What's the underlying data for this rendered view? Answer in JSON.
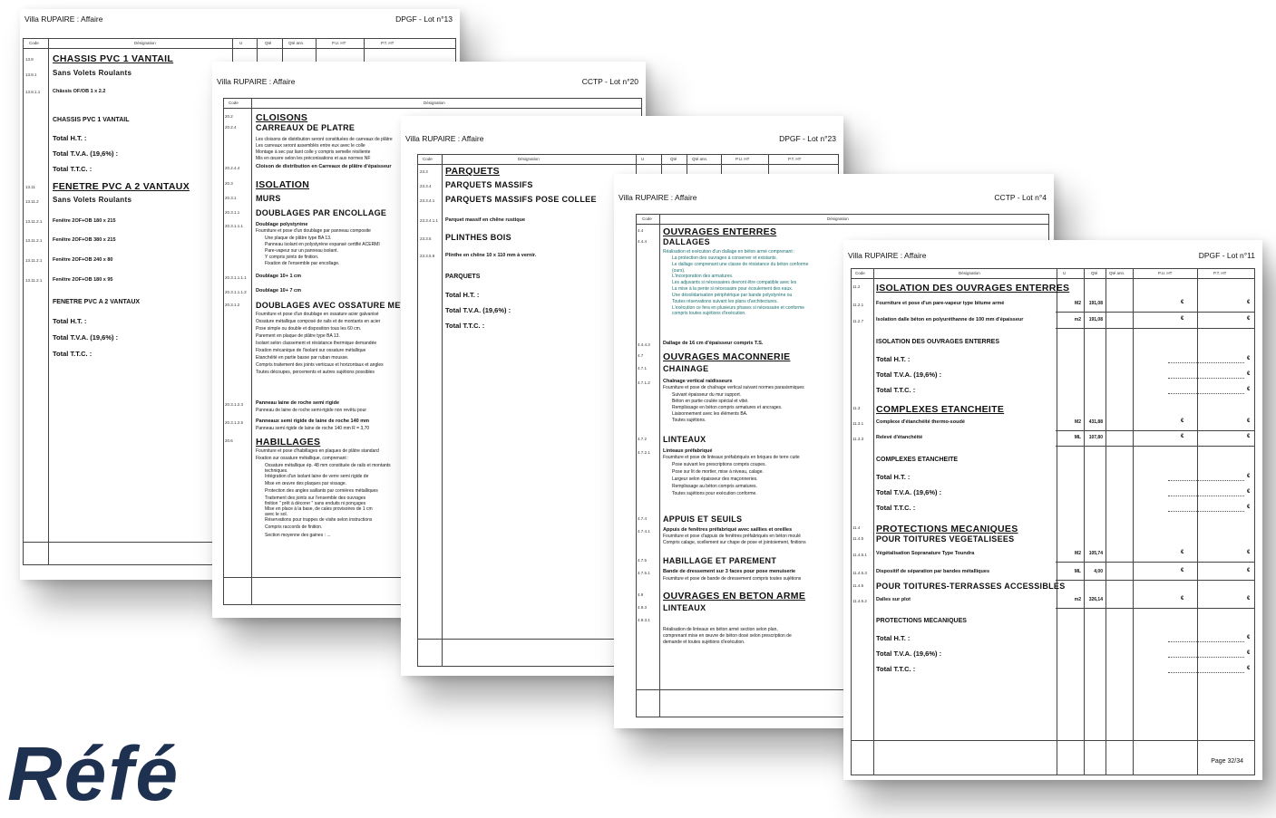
{
  "watermark": "Réfé",
  "p1": {
    "title_left": "Villa RUPAIRE : Affaire",
    "title_right": "DPGF - Lot n°13",
    "cols": {
      "code": "Code",
      "des": "Désignation",
      "u": "U",
      "qte": "Qté",
      "qteann": "Qté ann.",
      "pu": "P.U. HT",
      "pt": "P.T. HT"
    },
    "items": [
      {
        "code": "13.8",
        "text": "CHASSIS PVC 1 VANTAIL"
      },
      {
        "code": "13.8.1",
        "text": "Sans Volets Roulants"
      },
      {
        "code": "13.8.1.1",
        "text": "Châssis OF/OB 1 x 2.2"
      },
      {
        "code": "",
        "text": "CHASSIS PVC 1 VANTAIL"
      },
      {
        "code": "",
        "text": "Total H.T. :"
      },
      {
        "code": "",
        "text": "Total T.V.A. (19,6%) :"
      },
      {
        "code": "",
        "text": "Total T.T.C. :"
      },
      {
        "code": "13.11",
        "text": "FENETRE PVC A 2 VANTAUX"
      },
      {
        "code": "13.11.2",
        "text": "Sans Volets Roulants"
      },
      {
        "code": "13.11.2.1",
        "text": "Fenêtre 2OF+OB 180 x 215"
      },
      {
        "code": "13.11.2.1",
        "text": "Fenêtre 2OF+OB 380 x 215"
      },
      {
        "code": "13.11.2.1",
        "text": "Fenêtre 2OF+OB 240 x 80"
      },
      {
        "code": "13.11.2.1",
        "text": "Fenêtre 2OF+OB 180 x 95"
      },
      {
        "code": "",
        "text": "FENETRE PVC A 2 VANTAUX"
      },
      {
        "code": "",
        "text": "Total H.T. :"
      },
      {
        "code": "",
        "text": "Total T.V.A. (19,6%) :"
      },
      {
        "code": "",
        "text": "Total T.T.C. :"
      }
    ]
  },
  "p2": {
    "title_left": "Villa RUPAIRE : Affaire",
    "title_right": "CCTP - Lot n°20",
    "cols": {
      "code": "Code",
      "des": "Désignation"
    },
    "items": [
      {
        "code": "20.2",
        "text": "CLOISONS"
      },
      {
        "code": "20.2.4",
        "text": "CARREAUX DE PLATRE"
      },
      {
        "code": "",
        "text": "Les cloisons de distribution seront constituées de carreaux de plâtre"
      },
      {
        "code": "",
        "text": "Les carreaux seront assemblés entre eux avec le colle"
      },
      {
        "code": "",
        "text": "Montage à sec par liant colle y compris semelle résiliente"
      },
      {
        "code": "",
        "text": "Mis en œuvre selon les préconisations et aux normes NF"
      },
      {
        "code": "20.2.4.4",
        "text": "Cloison de distribution en Carreaux de plâtre d'épaisseur"
      },
      {
        "code": "20.3",
        "text": "ISOLATION"
      },
      {
        "code": "20.3.1",
        "text": "MURS"
      },
      {
        "code": "20.3.1.1",
        "text": "DOUBLAGES PAR ENCOLLAGE"
      },
      {
        "code": "20.3.1.1.1",
        "text": "Doublage polystyrène"
      },
      {
        "code": "",
        "text": "Fourniture et pose d'un doublage par panneau composite"
      },
      {
        "code": "",
        "text": "Une plaque de plâtre type BA 13."
      },
      {
        "code": "",
        "text": "Panneau isolant en polystyrène expansé certifié ACERMI"
      },
      {
        "code": "",
        "text": "Pare-vapeur sur un panneau isolant."
      },
      {
        "code": "",
        "text": "Y compris joints de finition."
      },
      {
        "code": "",
        "text": "Fixation de l'ensemble par encollage."
      },
      {
        "code": "20.3.1.1.1.1",
        "text": "Doublage 10+ 1 cm"
      },
      {
        "code": "20.3.1.1.1.2",
        "text": "Doublage 10+ 7 cm"
      },
      {
        "code": "20.3.1.2",
        "text": "DOUBLAGES AVEC OSSATURE METALLIQUE"
      },
      {
        "code": "",
        "text": "Fourniture et pose d'un doublage en ossature acier galvanisé"
      },
      {
        "code": "",
        "text": "Ossature métallique composé de rails et de montants en acier"
      },
      {
        "code": "",
        "text": "Pose simple ou double et disposition tous les 60 cm."
      },
      {
        "code": "",
        "text": "Parement en plaque de plâtre type BA 13."
      },
      {
        "code": "",
        "text": "Isolant selon classement et résistance thermique demandée"
      },
      {
        "code": "",
        "text": "Fixation mécanique de l'isolant sur ossature métallique"
      },
      {
        "code": "",
        "text": "Etanchéité en partie basse par ruban mousse."
      },
      {
        "code": "",
        "text": "Compris traitement des joints verticaux et horizontaux et angles"
      },
      {
        "code": "",
        "text": "Toutes découpes, percements et autres sujétions possibles"
      },
      {
        "code": "20.3.1.2.3",
        "text": "Panneau laine de roche semi rigide"
      },
      {
        "code": "",
        "text": "Panneau de laine de roche semi-rigide non revêtu pour"
      },
      {
        "code": "20.3.1.2.5",
        "text": "Panneaux semi rigide de laine de roche 140 mm"
      },
      {
        "code": "",
        "text": "Panneau semi rigide de laine de roche 140 mm R = 3,70"
      },
      {
        "code": "20.6",
        "text": "HABILLAGES"
      },
      {
        "code": "",
        "text": "Fourniture et pose d'habillages en plaques de plâtre standard"
      },
      {
        "code": "",
        "text": "Fixation sur ossature métallique, comprenant :"
      },
      {
        "code": "",
        "text": "Ossature métallique ép. 48 mm constituée de rails et montants"
      },
      {
        "code": "",
        "text": "techniques."
      },
      {
        "code": "",
        "text": "Intégration d'un isolant laine de verre semi rigide de"
      },
      {
        "code": "",
        "text": "Mise en œuvre des plaques par vissage."
      },
      {
        "code": "",
        "text": "Protection des angles saillants par cornières métalliques"
      },
      {
        "code": "",
        "text": "Traitement des joints sur l'ensemble des ouvrages"
      },
      {
        "code": "",
        "text": "finition \" prêt à décorer \" sans enduits ni ponçages"
      },
      {
        "code": "",
        "text": "Mise en place à la base, de cales provisoires de 1 cm"
      },
      {
        "code": "",
        "text": "avec le sol."
      },
      {
        "code": "",
        "text": "Réservations pour trappes de visite selon instructions"
      },
      {
        "code": "",
        "text": "Compris raccords de finition."
      },
      {
        "code": "",
        "text": "Section moyenne des gaines : ..."
      }
    ]
  },
  "p3": {
    "title_left": "Villa RUPAIRE : Affaire",
    "title_right": "DPGF - Lot n°23",
    "cols": {
      "code": "Code",
      "des": "Désignation",
      "u": "U",
      "qte": "Qté",
      "qteann": "Qté ann.",
      "pu": "P.U. HT",
      "pt": "P.T. HT"
    },
    "items": [
      {
        "code": "23.3",
        "text": "PARQUETS"
      },
      {
        "code": "23.3.4",
        "text": "PARQUETS MASSIFS"
      },
      {
        "code": "23.3.4.1",
        "text": "PARQUETS MASSIFS POSE COLLEE"
      },
      {
        "code": "23.3.4.1.1",
        "text": "Parquet massif en chêne rustique"
      },
      {
        "code": "23.3.5",
        "text": "PLINTHES BOIS"
      },
      {
        "code": "23.3.5.9",
        "text": "Plinthe en chêne 10 x 110 mm à vernir."
      },
      {
        "code": "",
        "text": "PARQUETS"
      },
      {
        "code": "",
        "text": "Total H.T. :"
      },
      {
        "code": "",
        "text": "Total T.V.A. (19,6%) :"
      },
      {
        "code": "",
        "text": "Total T.T.C. :"
      }
    ]
  },
  "p4": {
    "title_left": "Villa RUPAIRE : Affaire",
    "title_right": "CCTP - Lot n°4",
    "cols": {
      "code": "Code",
      "des": "Désignation"
    },
    "items": [
      {
        "code": "4.4",
        "text": "OUVRAGES ENTERRES"
      },
      {
        "code": "4.4.4",
        "text": "DALLAGES"
      },
      {
        "code": "",
        "text": "Réalisation et exécution d'un dallage en béton armé comprenant :"
      },
      {
        "code": "",
        "text": "La protection des ouvrages à conserver et existants."
      },
      {
        "code": "",
        "text": "Le dallage comprenant une classe de résistance du béton conforme"
      },
      {
        "code": "",
        "text": "(ours)."
      },
      {
        "code": "",
        "text": "L'incorporation des armatures."
      },
      {
        "code": "",
        "text": "Les adjuvants si nécessaires devront être compatible avec les"
      },
      {
        "code": "",
        "text": "La mise à la pente si nécessaire pour écoulement des eaux."
      },
      {
        "code": "",
        "text": "Une désolidarisation périphérique par bande polystyrène ou"
      },
      {
        "code": "",
        "text": "Toutes réservations suivant les plans d'architectures."
      },
      {
        "code": "",
        "text": "L'exécution ce fera en plusieurs phases si nécessaire et conforme"
      },
      {
        "code": "",
        "text": "compris toutes sujétions d'exécution."
      },
      {
        "code": "4.4.4.3",
        "text": "Dallage de 16 cm d'épaisseur compris T.S."
      },
      {
        "code": "4.7",
        "text": "OUVRAGES MACONNERIE"
      },
      {
        "code": "4.7.1",
        "text": "CHAINAGE"
      },
      {
        "code": "4.7.1.2",
        "text": "Chaînage vertical raidisseurs"
      },
      {
        "code": "",
        "text": "Fourniture et pose de chaînage vertical suivant normes parasismiques"
      },
      {
        "code": "",
        "text": "Suivant épaisseur du mur support."
      },
      {
        "code": "",
        "text": "Béton en partie coulée spécial et vibé."
      },
      {
        "code": "",
        "text": "Remplissage en béton compris armatures et ancrages."
      },
      {
        "code": "",
        "text": "Liaisonnement avec les éléments BA."
      },
      {
        "code": "",
        "text": "Toutes sujétions."
      },
      {
        "code": "4.7.2",
        "text": "LINTEAUX"
      },
      {
        "code": "4.7.2.1",
        "text": "Linteaux préfabriqué"
      },
      {
        "code": "",
        "text": "Fourniture et pose de linteaux préfabriqués en briques de terre cuite"
      },
      {
        "code": "",
        "text": "Pose suivant les prescriptions compris coupes."
      },
      {
        "code": "",
        "text": "Pose sur lit de mortier, mise à niveau, calage."
      },
      {
        "code": "",
        "text": "Largeur selon épaisseur des maçonneries."
      },
      {
        "code": "",
        "text": "Remplissage au béton compris armatures."
      },
      {
        "code": "",
        "text": "Toutes sujétions pour exécution conforme."
      },
      {
        "code": "4.7.4",
        "text": "APPUIS ET SEUILS"
      },
      {
        "code": "4.7.4.1",
        "text": "Appuis de fenêtres préfabriqué avec saillies et oreilles"
      },
      {
        "code": "",
        "text": "Fourniture et pose d'appuis de fenêtres préfabriqués en béton moulé"
      },
      {
        "code": "",
        "text": "Compris calage, scellement sur chape de pose et jointoiement, finitions"
      },
      {
        "code": "4.7.5",
        "text": "HABILLAGE ET PAREMENT"
      },
      {
        "code": "4.7.5.1",
        "text": "Bande de dressement sur 3 faces pour pose menuiserie"
      },
      {
        "code": "",
        "text": "Fourniture et pose de bande de dressement compris toutes sujétions"
      },
      {
        "code": "4.9",
        "text": "OUVRAGES EN BETON ARME"
      },
      {
        "code": "4.9.3",
        "text": "LINTEAUX"
      },
      {
        "code": "4.9.3.1",
        "text": ""
      },
      {
        "code": "",
        "text": "Réalisation de linteaux en béton armé section selon plan,"
      },
      {
        "code": "",
        "text": "comprenant mise en œuvre de béton dosé selon prescription de"
      },
      {
        "code": "",
        "text": "demande et toutes sujétions d'exécution."
      }
    ]
  },
  "p5": {
    "title_left": "Villa RUPAIRE : Affaire",
    "title_right": "DPGF - Lot n°11",
    "cols": {
      "code": "Code",
      "des": "Désignation",
      "u": "U",
      "qte": "Qté",
      "qteann": "Qté ann.",
      "pu": "P.U. HT",
      "pt": "P.T. HT"
    },
    "items": [
      {
        "code": "11.2",
        "text": "ISOLATION DES OUVRAGES ENTERRES",
        "u": "",
        "qte": ""
      },
      {
        "code": "11.2.1",
        "text": "Fourniture et pose d'un pare-vapeur type bitume armé",
        "u": "M2",
        "qte": "191,08"
      },
      {
        "code": "11.2.7",
        "text": "Isolation dalle béton en polyuréthanne de 100 mm d'épaisseur",
        "u": "m2",
        "qte": "191,08"
      },
      {
        "code": "",
        "text": "ISOLATION DES OUVRAGES ENTERRES",
        "u": "",
        "qte": ""
      },
      {
        "code": "",
        "text": "Total H.T. :",
        "u": "",
        "qte": ""
      },
      {
        "code": "",
        "text": "Total T.V.A. (19,6%) :",
        "u": "",
        "qte": ""
      },
      {
        "code": "",
        "text": "Total T.T.C. :",
        "u": "",
        "qte": ""
      },
      {
        "code": "11.3",
        "text": "COMPLEXES ETANCHEITE",
        "u": "",
        "qte": ""
      },
      {
        "code": "11.3.1",
        "text": "Complexe d'étanchéité thermo-soudé",
        "u": "M2",
        "qte": "431,88"
      },
      {
        "code": "11.3.3",
        "text": "Relevé d'étanchéité",
        "u": "ML",
        "qte": "107,80"
      },
      {
        "code": "",
        "text": "COMPLEXES ETANCHEITE",
        "u": "",
        "qte": ""
      },
      {
        "code": "",
        "text": "Total H.T. :",
        "u": "",
        "qte": ""
      },
      {
        "code": "",
        "text": "Total T.V.A. (19,6%) :",
        "u": "",
        "qte": ""
      },
      {
        "code": "",
        "text": "Total T.T.C. :",
        "u": "",
        "qte": ""
      },
      {
        "code": "11.4",
        "text": "PROTECTIONS MECANIQUES",
        "u": "",
        "qte": ""
      },
      {
        "code": "11.4.5",
        "text": "POUR TOITURES VEGETALISEES",
        "u": "",
        "qte": ""
      },
      {
        "code": "11.4.5.1",
        "text": "Végétalisation Sopranature Type Toundra",
        "u": "M2",
        "qte": "105,74"
      },
      {
        "code": "11.4.5.3",
        "text": "Dispositif de séparation par bandes métalliques",
        "u": "ML",
        "qte": "4,00"
      },
      {
        "code": "11.4.6",
        "text": "POUR TOITURES-TERRASSES ACCESSIBLES",
        "u": "",
        "qte": ""
      },
      {
        "code": "11.4.6.2",
        "text": "Dalles sur plot",
        "u": "m2",
        "qte": "326,14"
      },
      {
        "code": "",
        "text": "PROTECTIONS MECANIQUES",
        "u": "",
        "qte": ""
      },
      {
        "code": "",
        "text": "Total H.T. :",
        "u": "",
        "qte": ""
      },
      {
        "code": "",
        "text": "Total T.V.A. (19,6%) :",
        "u": "",
        "qte": ""
      },
      {
        "code": "",
        "text": "Total T.T.C. :",
        "u": "",
        "qte": ""
      }
    ],
    "euro": "€",
    "page": "Page 32/34"
  }
}
